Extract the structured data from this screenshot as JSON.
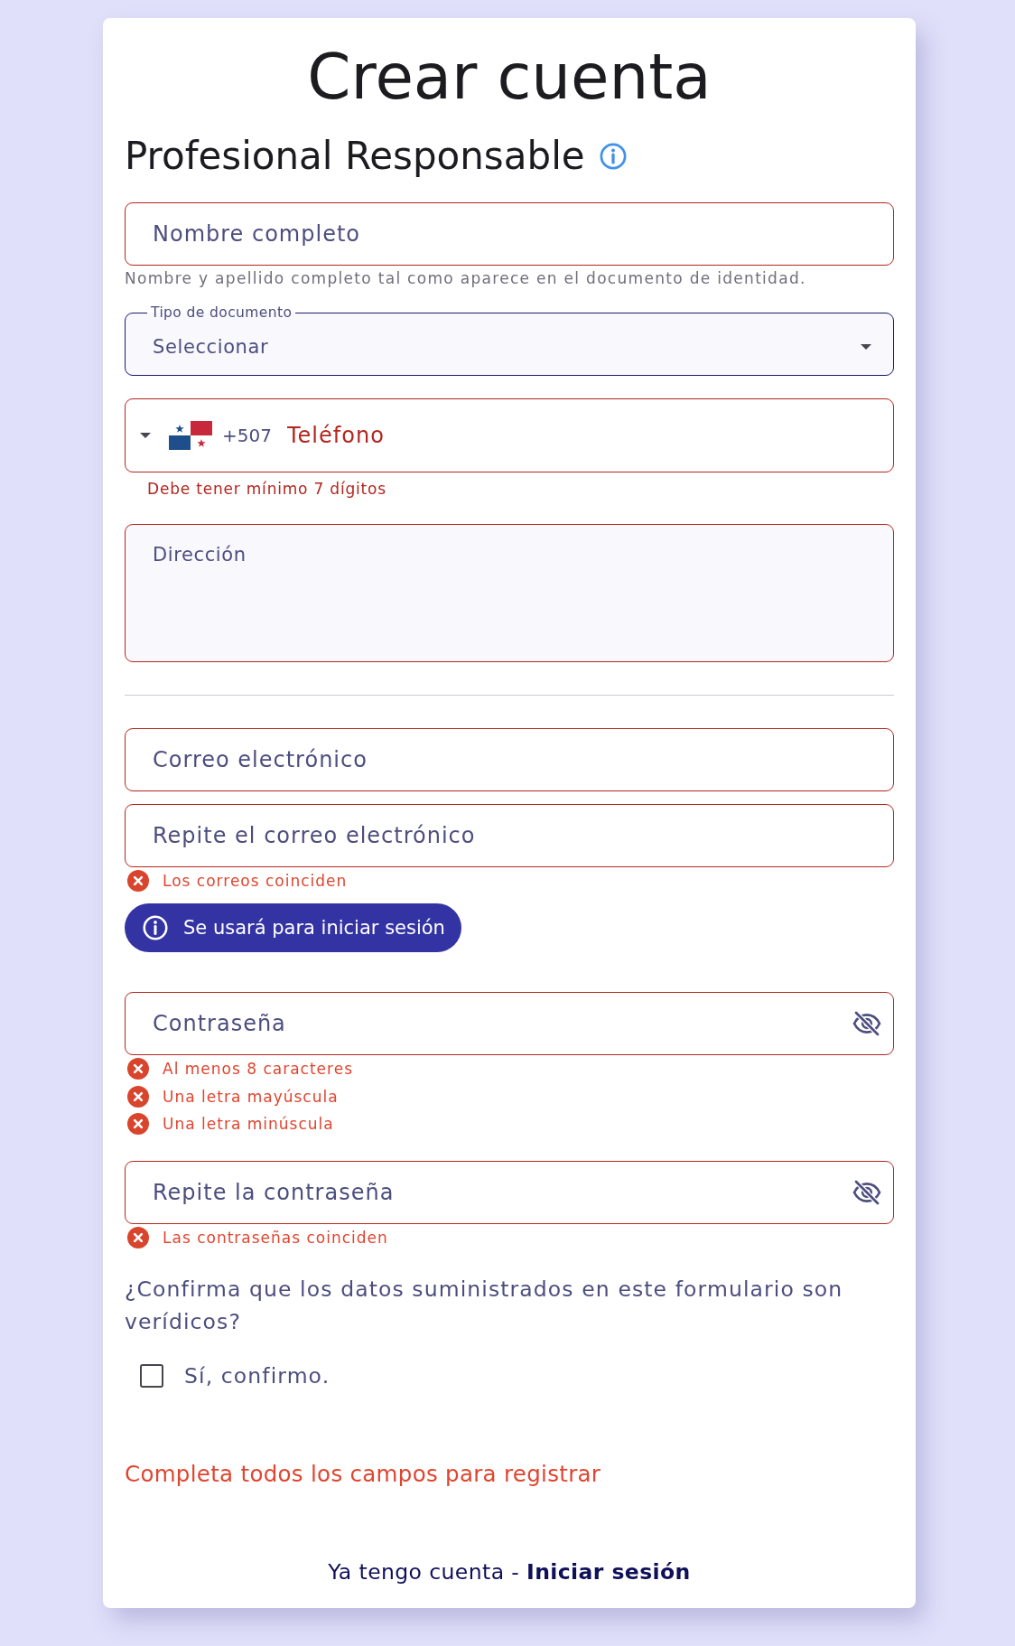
{
  "title": "Crear cuenta",
  "section": {
    "title": "Profesional Responsable"
  },
  "personal_fields": [
    {
      "kind": "text",
      "placeholder": "Nombre completo",
      "invalid": true,
      "helper": "Nombre y apellido completo tal como aparece en el documento de identidad."
    },
    {
      "kind": "select",
      "label": "Tipo de documento",
      "value": "Seleccionar",
      "invalid": false
    },
    {
      "kind": "phone",
      "dial_code": "+507",
      "placeholder": "Teléfono",
      "invalid": true,
      "error": "Debe tener mínimo 7 dígitos"
    },
    {
      "kind": "textarea",
      "placeholder": "Dirección",
      "invalid": true
    }
  ],
  "email_fields": [
    {
      "placeholder": "Correo electrónico",
      "invalid": true
    },
    {
      "placeholder": "Repite el correo electrónico",
      "invalid": true
    }
  ],
  "email_checks": [
    {
      "text": "Los correos coinciden",
      "met": false
    }
  ],
  "email_note": "Se usará para iniciar sesión",
  "password_fields": [
    {
      "placeholder": "Contraseña",
      "invalid": true,
      "visible": false,
      "checks": [
        {
          "text": "Al menos 8 caracteres",
          "met": false
        },
        {
          "text": "Una letra mayúscula",
          "met": false
        },
        {
          "text": "Una letra minúscula",
          "met": false
        }
      ]
    },
    {
      "placeholder": "Repite la contraseña",
      "invalid": true,
      "visible": false,
      "checks": [
        {
          "text": "Las contraseñas coinciden",
          "met": false
        }
      ]
    }
  ],
  "confirmation": {
    "question": "¿Confirma que los datos suministrados en este formulario son verídicos?",
    "label": "Sí, confirmo.",
    "checked": false
  },
  "status_message": "Completa todos los campos para registrar",
  "footer": {
    "text": "Ya tengo cuenta -",
    "link": "Iniciar sesión"
  }
}
